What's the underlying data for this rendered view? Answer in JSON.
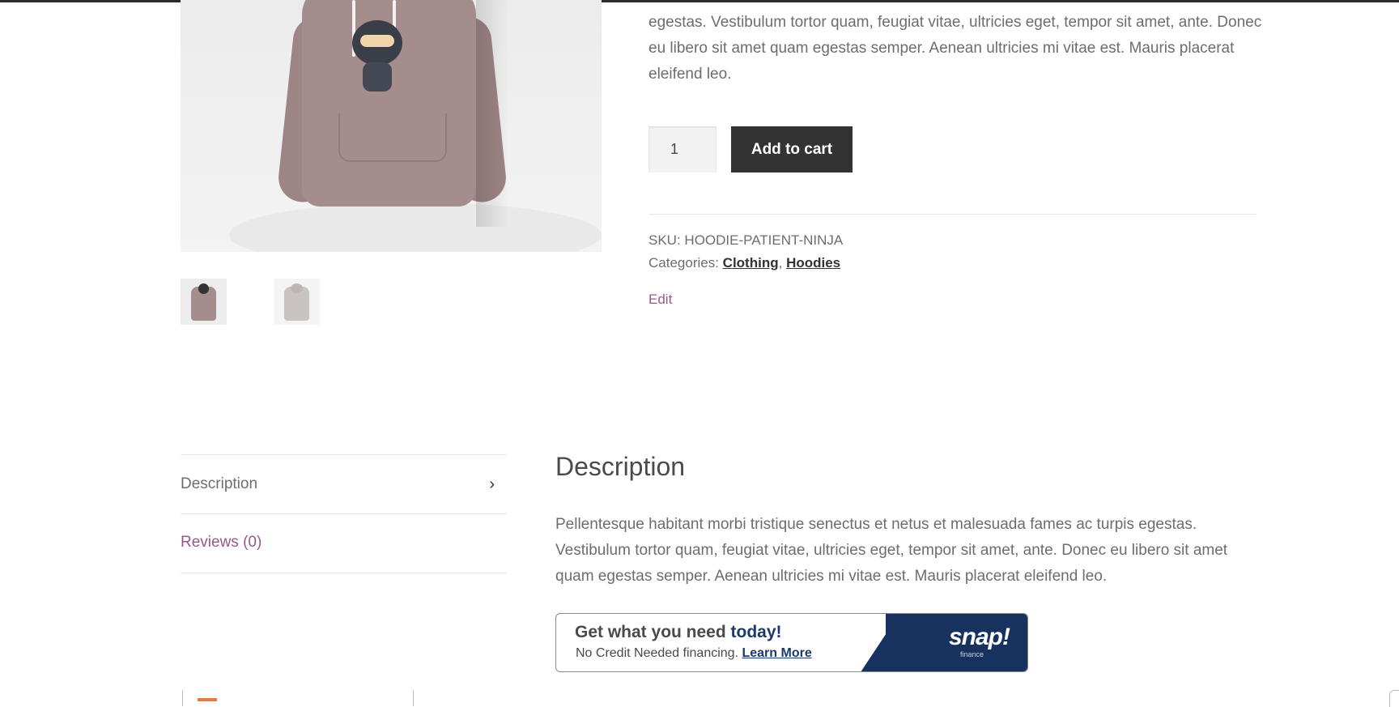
{
  "product": {
    "description_excerpt": "egestas. Vestibulum tortor quam, feugiat vitae, ultricies eget, tempor sit amet, ante. Donec eu libero sit amet quam egestas semper. Aenean ultricies mi vitae est. Mauris placerat eleifend leo.",
    "quantity": "1",
    "add_to_cart_label": "Add to cart",
    "sku_label": "SKU:",
    "sku_value": "HOODIE-PATIENT-NINJA",
    "categories_label": "Categories:",
    "categories": [
      "Clothing",
      "Hoodies"
    ],
    "category_separator": ",",
    "edit_label": "Edit"
  },
  "tabs": [
    {
      "label": "Description",
      "active": true
    },
    {
      "label": "Reviews (0)",
      "active": false
    }
  ],
  "panel": {
    "title": "Description",
    "text": "Pellentesque habitant morbi tristique senectus et netus et malesuada fames ac turpis egestas. Vestibulum tortor quam, feugiat vitae, ultricies eget, tempor sit amet, ante. Donec eu libero sit amet quam egestas semper. Aenean ultricies mi vitae est. Mauris placerat eleifend leo."
  },
  "snap_banner": {
    "headline_prefix": "Get what you need ",
    "headline_highlight": "today!",
    "subtext": "No Credit Needed financing.",
    "learn_more": "Learn More",
    "logo_text": "snap!",
    "logo_subtext": "finance"
  },
  "icons": {
    "tab_chevron": "chevron-right-icon"
  },
  "colors": {
    "button_bg": "#333333",
    "link_purple": "#96588a",
    "snap_navy": "#17325f"
  }
}
